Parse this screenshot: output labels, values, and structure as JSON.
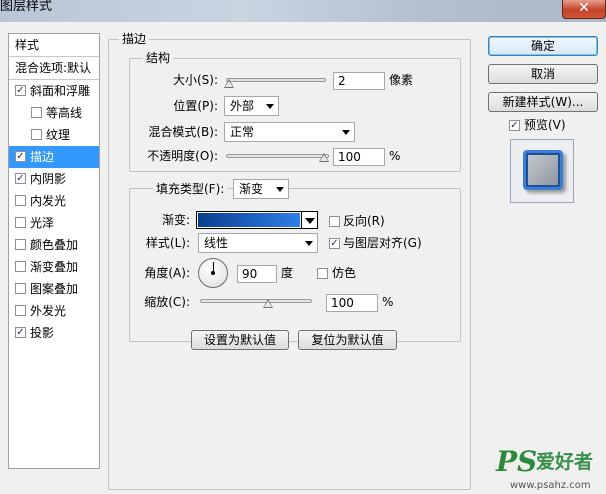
{
  "window": {
    "title": "图层样式",
    "close_glyph": "✕"
  },
  "style_list": {
    "header": "样式",
    "blend_options": "混合选项:默认",
    "items": [
      {
        "label": "斜面和浮雕",
        "checked": true
      },
      {
        "label": "等高线",
        "checked": false
      },
      {
        "label": "纹理",
        "checked": false
      },
      {
        "label": "描边",
        "checked": true,
        "selected": true
      },
      {
        "label": "内阴影",
        "checked": true
      },
      {
        "label": "内发光",
        "checked": false
      },
      {
        "label": "光泽",
        "checked": false
      },
      {
        "label": "颜色叠加",
        "checked": false
      },
      {
        "label": "渐变叠加",
        "checked": false
      },
      {
        "label": "图案叠加",
        "checked": false
      },
      {
        "label": "外发光",
        "checked": false
      },
      {
        "label": "投影",
        "checked": true
      }
    ]
  },
  "stroke": {
    "legend": "描边",
    "structure": {
      "legend": "结构",
      "size_label": "大小(S):",
      "size_value": "2",
      "size_unit": "像素",
      "size_slider": 0.0,
      "position_label": "位置(P):",
      "position_value": "外部",
      "blend_label": "混合模式(B):",
      "blend_value": "正常",
      "opacity_label": "不透明度(O):",
      "opacity_value": "100",
      "opacity_unit": "%",
      "opacity_slider": 1.0
    },
    "fill": {
      "type_label": "填充类型(F):",
      "type_value": "渐变",
      "gradient_label": "渐变:",
      "gradient_from": "#0a3f8f",
      "gradient_to": "#2f7ee8",
      "reverse_label": "反向(R)",
      "reverse_checked": false,
      "style_label": "样式(L):",
      "style_value": "线性",
      "align_label": "与图层对齐(G)",
      "align_checked": true,
      "angle_label": "角度(A):",
      "angle_value": "90",
      "angle_unit": "度",
      "dither_label": "仿色",
      "dither_checked": false,
      "scale_label": "缩放(C):",
      "scale_value": "100",
      "scale_unit": "%",
      "scale_slider": 0.5
    },
    "make_default": "设置为默认值",
    "reset_default": "复位为默认值"
  },
  "buttons": {
    "ok": "确定",
    "cancel": "取消",
    "new_style": "新建样式(W)...",
    "preview_label": "预览(V)",
    "preview_checked": true
  },
  "watermark": {
    "ps": "PS",
    "cn": "爱好者",
    "url": "www.psahz.com"
  },
  "check_glyph": "✓"
}
